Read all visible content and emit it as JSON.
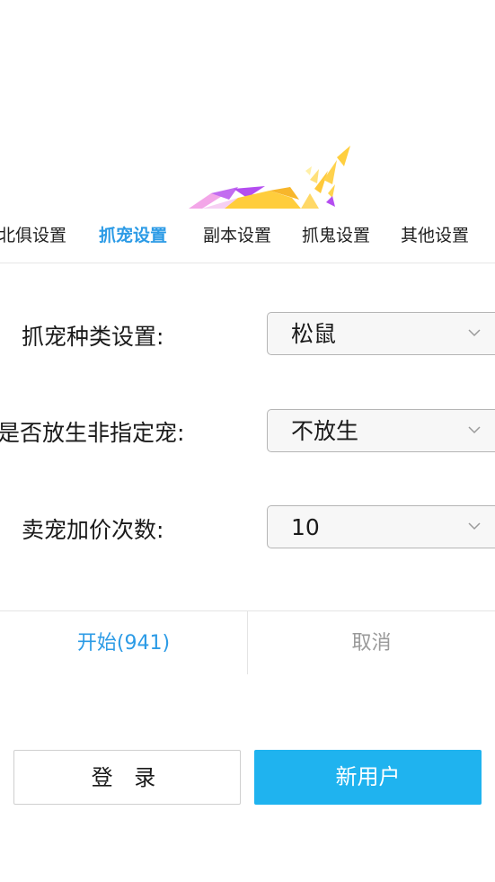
{
  "tabs": [
    {
      "label": "北俱设置"
    },
    {
      "label": "抓宠设置"
    },
    {
      "label": "副本设置"
    },
    {
      "label": "抓鬼设置"
    },
    {
      "label": "其他设置"
    }
  ],
  "form": {
    "pet_type": {
      "label": "抓宠种类设置:",
      "value": "松鼠"
    },
    "release": {
      "label": "是否放生非指定宠:",
      "value": "不放生"
    },
    "raise_price": {
      "label": "卖宠加价次数:",
      "value": "10"
    }
  },
  "dialog": {
    "start_label": "开始(941)",
    "cancel_label": "取消"
  },
  "auth": {
    "login_label": "登 录",
    "new_user_label": "新用户"
  },
  "colors": {
    "accent": "#2c9be6",
    "primary_button": "#1fb3ef"
  }
}
